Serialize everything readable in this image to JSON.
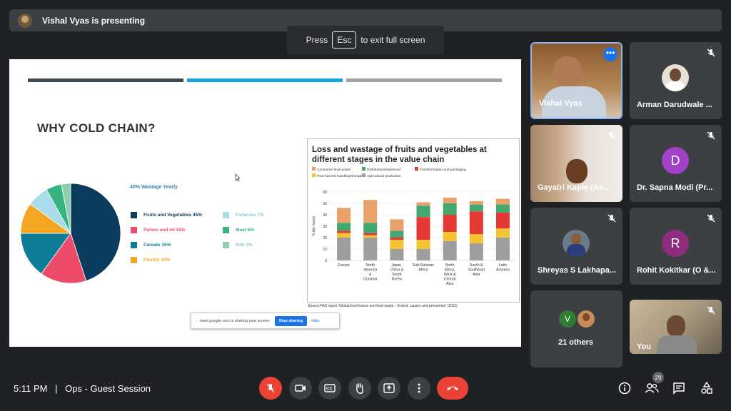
{
  "presenter": {
    "text": "Vishal Vyas is presenting"
  },
  "fullscreen_toast": {
    "prefix": "Press",
    "key": "Esc",
    "suffix": "to exit full screen"
  },
  "slide": {
    "title": "WHY COLD CHAIN?",
    "stripe_colors": [
      "#3d4a52",
      "#1ba1e2",
      "#9fa4a8"
    ],
    "wastage_label": "40% Wastage Yearly",
    "legend": [
      {
        "label": "Fruits and Vegetables 45%",
        "color": "#0b3c5d",
        "text_color": "#0b3c5d"
      },
      {
        "label": "Pulses and oil 15%",
        "color": "#ee4b6a",
        "text_color": "#ee4b6a"
      },
      {
        "label": "Cereals 15%",
        "color": "#0e7c97",
        "text_color": "#0e7c97"
      },
      {
        "label": "Poultry 10%",
        "color": "#f5a623",
        "text_color": "#f5a623"
      },
      {
        "label": "Fisheries 7%",
        "color": "#a8dcea",
        "text_color": "#8fc6d6"
      },
      {
        "label": "Meat 5%",
        "color": "#36b37e",
        "text_color": "#36b37e"
      },
      {
        "label": "Milk 3%",
        "color": "#8fcfb0",
        "text_color": "#8fcfb0"
      }
    ],
    "share_bar": {
      "text": "meet.google.com is sharing your screen.",
      "stop": "Stop sharing",
      "hide": "Hide"
    },
    "source": "Source:FAO report 'Global food losses and food waste – Extent, causes and prevention' (2011)"
  },
  "chart_data": [
    {
      "type": "pie",
      "categories": [
        "Fruits and Vegetables",
        "Pulses and oil",
        "Cereals",
        "Poultry",
        "Fisheries",
        "Meat",
        "Milk"
      ],
      "values": [
        45,
        15,
        15,
        10,
        7,
        5,
        3
      ]
    },
    {
      "type": "bar",
      "title": "Loss and wastage of fruits and vegetables at different stages in the value chain",
      "ylabel": "% (by mass)",
      "ylim": [
        0,
        60
      ],
      "yticks": [
        0,
        10,
        20,
        30,
        40,
        50,
        60
      ],
      "categories": [
        "Europe",
        "North America & Oceania",
        "Japan, China & South Korea",
        "Sub-Saharan Africa",
        "North Africa, West & Central Asia",
        "South & Southeast Asia",
        "Latin America"
      ],
      "series": [
        {
          "name": "Agricultural production",
          "color": "#9e9e9e",
          "values": [
            20,
            20,
            10,
            10,
            17,
            15,
            20
          ]
        },
        {
          "name": "Post-harvest handling/storage",
          "color": "#f4c430",
          "values": [
            4,
            2,
            8,
            8,
            8,
            8,
            8
          ]
        },
        {
          "name": "Transformation and packaging",
          "color": "#e53935",
          "values": [
            2,
            2,
            2,
            20,
            15,
            20,
            14
          ]
        },
        {
          "name": "Distribution/retail level",
          "color": "#43a870",
          "values": [
            7,
            9,
            6,
            10,
            10,
            6,
            7
          ]
        },
        {
          "name": "Consumer level waste",
          "color": "#e8a16a",
          "values": [
            13,
            20,
            10,
            3,
            5,
            3,
            5
          ]
        }
      ]
    }
  ],
  "tiles": [
    {
      "name": "Vishal Vyas",
      "kind": "video"
    },
    {
      "name": "Arman Darudwale ...",
      "kind": "photo"
    },
    {
      "name": "Gayatri Kaple (As...",
      "kind": "video"
    },
    {
      "name": "Dr. Sapna Modi (Pr...",
      "kind": "letter",
      "letter": "D",
      "color": "#a142c9"
    },
    {
      "name": "Shreyas S Lakhapa...",
      "kind": "photo"
    },
    {
      "name": "Rohit Kokitkar (O &...",
      "kind": "letter",
      "letter": "R",
      "color": "#8e2d7f"
    },
    {
      "name": "21 others",
      "kind": "others",
      "letter": "V",
      "color": "#2e7d32"
    },
    {
      "name": "You",
      "kind": "video"
    }
  ],
  "bottom": {
    "time": "5:11 PM",
    "separator": "|",
    "meeting": "Ops - Guest Session",
    "people_count": "29"
  },
  "icons": [
    "mic-off-icon",
    "camera-icon",
    "captions-icon",
    "raise-hand-icon",
    "present-icon",
    "more-icon",
    "hangup-icon",
    "info-icon",
    "people-icon",
    "chat-icon",
    "activities-icon"
  ]
}
